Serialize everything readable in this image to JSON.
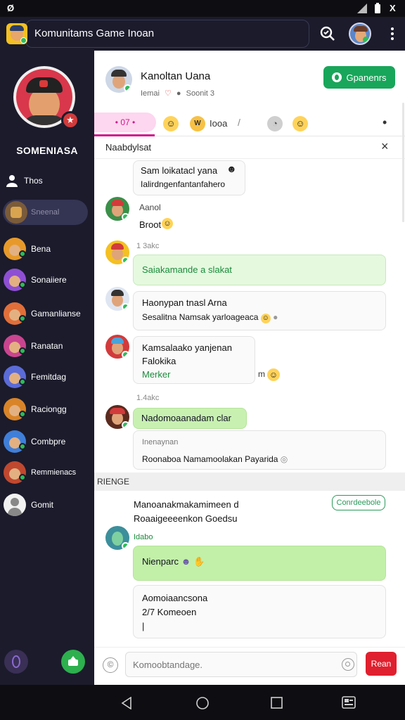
{
  "app": {
    "title": "Komunitams Game Inoan"
  },
  "statusbar": {
    "left_icon": "Ø",
    "signal_icon": "signal-icon",
    "battery_icon": "battery-icon",
    "close_icon": "X"
  },
  "profile": {
    "name": "SOMENIASA",
    "badge": "★"
  },
  "sidebar": {
    "items": [
      {
        "label": "Thos",
        "icon": "person-icon"
      },
      {
        "label": "Sneenal",
        "active": true
      },
      {
        "label": "Bena",
        "color": "#e79a2a"
      },
      {
        "label": "Sonaiiere",
        "color": "#8f4fd3"
      },
      {
        "label": "Gamanlianse",
        "color": "#e16f3a"
      },
      {
        "label": "Ranatan",
        "color": "#c9458f"
      },
      {
        "label": "Femitdag",
        "color": "#5b6bd8"
      },
      {
        "label": "Raciongg",
        "color": "#d98428"
      },
      {
        "label": "Combpre",
        "color": "#3f7fd9"
      },
      {
        "label": "Remmienacs",
        "color": "#c0482e"
      },
      {
        "label": "Gomit",
        "color": "#f2f2f2"
      }
    ]
  },
  "chat": {
    "name": "Kanoltan Uana",
    "subtitle": "Iemai",
    "subtitle_extra": "Soonit 3",
    "join_button": "Gpanenrs",
    "tab_active": "• 07 •",
    "tab_text": "Iooa",
    "subheader": "Naabdylsat",
    "close_icon": "×"
  },
  "messages": [
    {
      "lines": [
        "Sam loikatacl yana",
        "Ialirdngenfantanfahero"
      ]
    },
    {
      "name": "Aanol",
      "text": "Broot"
    },
    {
      "time": "1 3akc",
      "text": "Saiakamande a slakat"
    },
    {
      "lines": [
        "Haonypan tnasl Arna",
        "Sesalitna Namsak yarloageaca"
      ]
    },
    {
      "lines": [
        "Kamsalaako yanjenan",
        "Falokika",
        "Merker"
      ],
      "reaction": "m"
    },
    {
      "time": "1.4akc",
      "text": "Nadomoaanadam clar"
    },
    {
      "lines": [
        "Inenaynan",
        "Roonaboa Namamoolakan Payarida"
      ]
    }
  ],
  "section": {
    "label": "RIENGE"
  },
  "post": {
    "lines": [
      "Manoanakmakamimeen d",
      "Roaaigeeeenkon Goedsu"
    ],
    "button": "Conrdeebole",
    "time": "Idabo",
    "green_text": "Nienparc",
    "box_lines": [
      "Aomoiaancsona",
      "2/7 Komeoen",
      "|"
    ]
  },
  "composer": {
    "placeholder": "Komoobtandage.",
    "send_label": "Rean"
  },
  "colors": {
    "accent_green": "#18a65a",
    "accent_pink": "#d0158c",
    "send_red": "#e0202e",
    "sidebar_bg": "#1b1b2c"
  }
}
